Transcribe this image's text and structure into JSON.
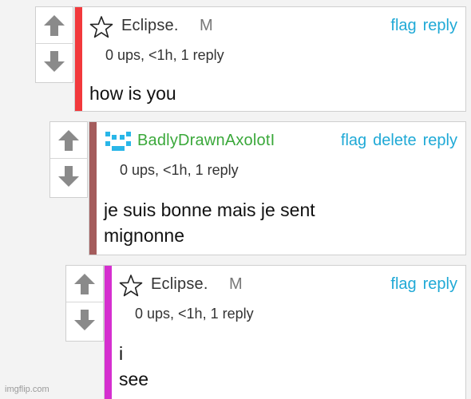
{
  "comments": [
    {
      "username": "Eclipse.",
      "rank": "M",
      "avatar": "star-outline-icon",
      "actions": {
        "flag": "flag",
        "reply": "reply"
      },
      "meta": "0 ups, <1h, 1 reply",
      "lines": [
        "how is you"
      ],
      "stripe_color": "#f2393c"
    },
    {
      "username": "BadlyDrawnAxolotI",
      "avatar": "pixel-face-icon",
      "actions": {
        "flag": "flag",
        "delete": "delete",
        "reply": "reply"
      },
      "meta": "0 ups, <1h, 1 reply",
      "lines": [
        "je suis bonne mais je sent",
        "mignonne"
      ],
      "stripe_color": "#a45c5c"
    },
    {
      "username": "Eclipse.",
      "rank": "M",
      "avatar": "star-outline-icon",
      "actions": {
        "flag": "flag",
        "reply": "reply"
      },
      "meta": "0 ups, <1h, 1 reply",
      "lines": [
        "i",
        "see"
      ],
      "stripe_color": "#d52fcf"
    }
  ],
  "colors": {
    "link": "#1fa9d6",
    "username_green": "#3aa83a"
  },
  "watermark": "imgflip.com"
}
